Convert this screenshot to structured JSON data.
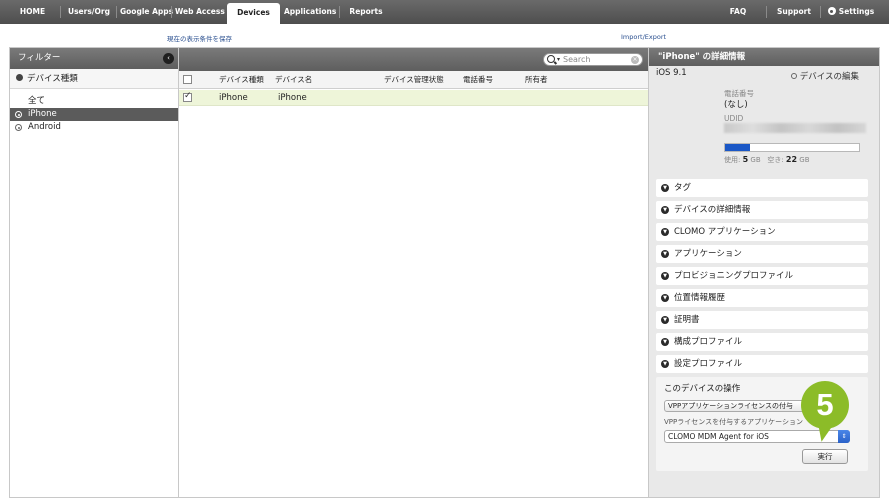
{
  "nav": {
    "tabs": [
      "HOME",
      "Users/Org",
      "Google Apps",
      "Web Access",
      "Devices",
      "Applications",
      "Reports"
    ],
    "active_tab": "Devices",
    "right": [
      "FAQ",
      "Support",
      "Settings"
    ]
  },
  "links": {
    "save_view": "現在の表示条件を保存",
    "import_export": "Import/Export"
  },
  "filter": {
    "title": "フィルター",
    "section": "デバイス種類",
    "items": [
      "全て",
      "iPhone",
      "Android"
    ],
    "selected": "iPhone"
  },
  "search": {
    "placeholder": "Search"
  },
  "table": {
    "headers": [
      "デバイス種類",
      "デバイス名",
      "デバイス管理状態",
      "電話番号",
      "所有者"
    ],
    "rows": [
      {
        "device_type": "iPhone",
        "device_name": "iPhone",
        "checked": true
      }
    ]
  },
  "detail": {
    "title": "\"iPhone\" の詳細情報",
    "os": "iOS 9.1",
    "edit_label": "デバイスの編集",
    "phone_label": "電話番号",
    "phone_value": "(なし)",
    "udid_label": "UDID",
    "storage_used_fraction": 0.19,
    "usage_used_label": "使用:",
    "usage_used_value": "5",
    "usage_used_unit": "GB",
    "usage_free_label": "空き:",
    "usage_free_value": "22",
    "usage_free_unit": "GB",
    "sections": [
      "タグ",
      "デバイスの詳細情報",
      "CLOMO アプリケーション",
      "アプリケーション",
      "プロビジョニングプロファイル",
      "位置情報履歴",
      "証明書",
      "構成プロファイル",
      "設定プロファイル"
    ]
  },
  "operations": {
    "title": "このデバイスの操作",
    "vpp_button": "VPPアプリケーションライセンスの付与",
    "vpp_label": "VPPライセンスを付与するアプリケーション",
    "selected_app": "CLOMO MDM Agent for iOS",
    "execute": "実行"
  },
  "marker": {
    "step": "5",
    "color": "#8cbc28"
  },
  "colors": {
    "accent": "#1a57c6",
    "selected_row": "#eef5d9"
  }
}
